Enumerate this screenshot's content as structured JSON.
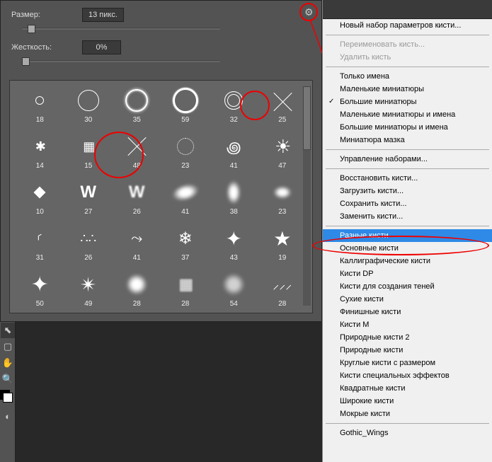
{
  "controls": {
    "size_label": "Размер:",
    "size_value": "13 пикс.",
    "hardness_label": "Жесткость:",
    "hardness_value": "0%"
  },
  "brushes": [
    {
      "n": "18"
    },
    {
      "n": "30"
    },
    {
      "n": "35"
    },
    {
      "n": "59"
    },
    {
      "n": "32"
    },
    {
      "n": "25"
    },
    {
      "n": "14"
    },
    {
      "n": "15"
    },
    {
      "n": "48"
    },
    {
      "n": "23"
    },
    {
      "n": "41"
    },
    {
      "n": "47"
    },
    {
      "n": "10"
    },
    {
      "n": "27"
    },
    {
      "n": "26"
    },
    {
      "n": "41"
    },
    {
      "n": "38"
    },
    {
      "n": "23"
    },
    {
      "n": "31"
    },
    {
      "n": "26"
    },
    {
      "n": "41"
    },
    {
      "n": "37"
    },
    {
      "n": "43"
    },
    {
      "n": "19"
    },
    {
      "n": "50"
    },
    {
      "n": "49"
    },
    {
      "n": "28"
    },
    {
      "n": "28"
    },
    {
      "n": "54"
    },
    {
      "n": "28"
    }
  ],
  "menu": {
    "new_preset": "Новый набор параметров кисти...",
    "rename": "Переименовать кисть...",
    "delete": "Удалить кисть",
    "text_only": "Только имена",
    "small_thumb": "Маленькие миниатюры",
    "large_thumb": "Большие миниатюры",
    "small_list": "Маленькие миниатюры и имена",
    "large_list": "Большие миниатюры и имена",
    "stroke_thumb": "Миниатюра мазка",
    "preset_mgr": "Управление наборами...",
    "reset": "Восстановить кисти...",
    "load": "Загрузить кисти...",
    "save": "Сохранить кисти...",
    "replace": "Заменить кисти...",
    "assorted": "Разные кисти",
    "basic": "Основные кисти",
    "calligraphic": "Каллиграфические кисти",
    "dp": "Кисти DP",
    "shadow": "Кисти для создания теней",
    "dry": "Сухие кисти",
    "finish": "Финишные кисти",
    "m": "Кисти M",
    "natural2": "Природные кисти 2",
    "natural": "Природные кисти",
    "round_size": "Круглые кисти с размером",
    "special": "Кисти специальных эффектов",
    "square": "Квадратные кисти",
    "wide": "Широкие кисти",
    "wet": "Мокрые кисти",
    "gothic": "Gothic_Wings"
  }
}
